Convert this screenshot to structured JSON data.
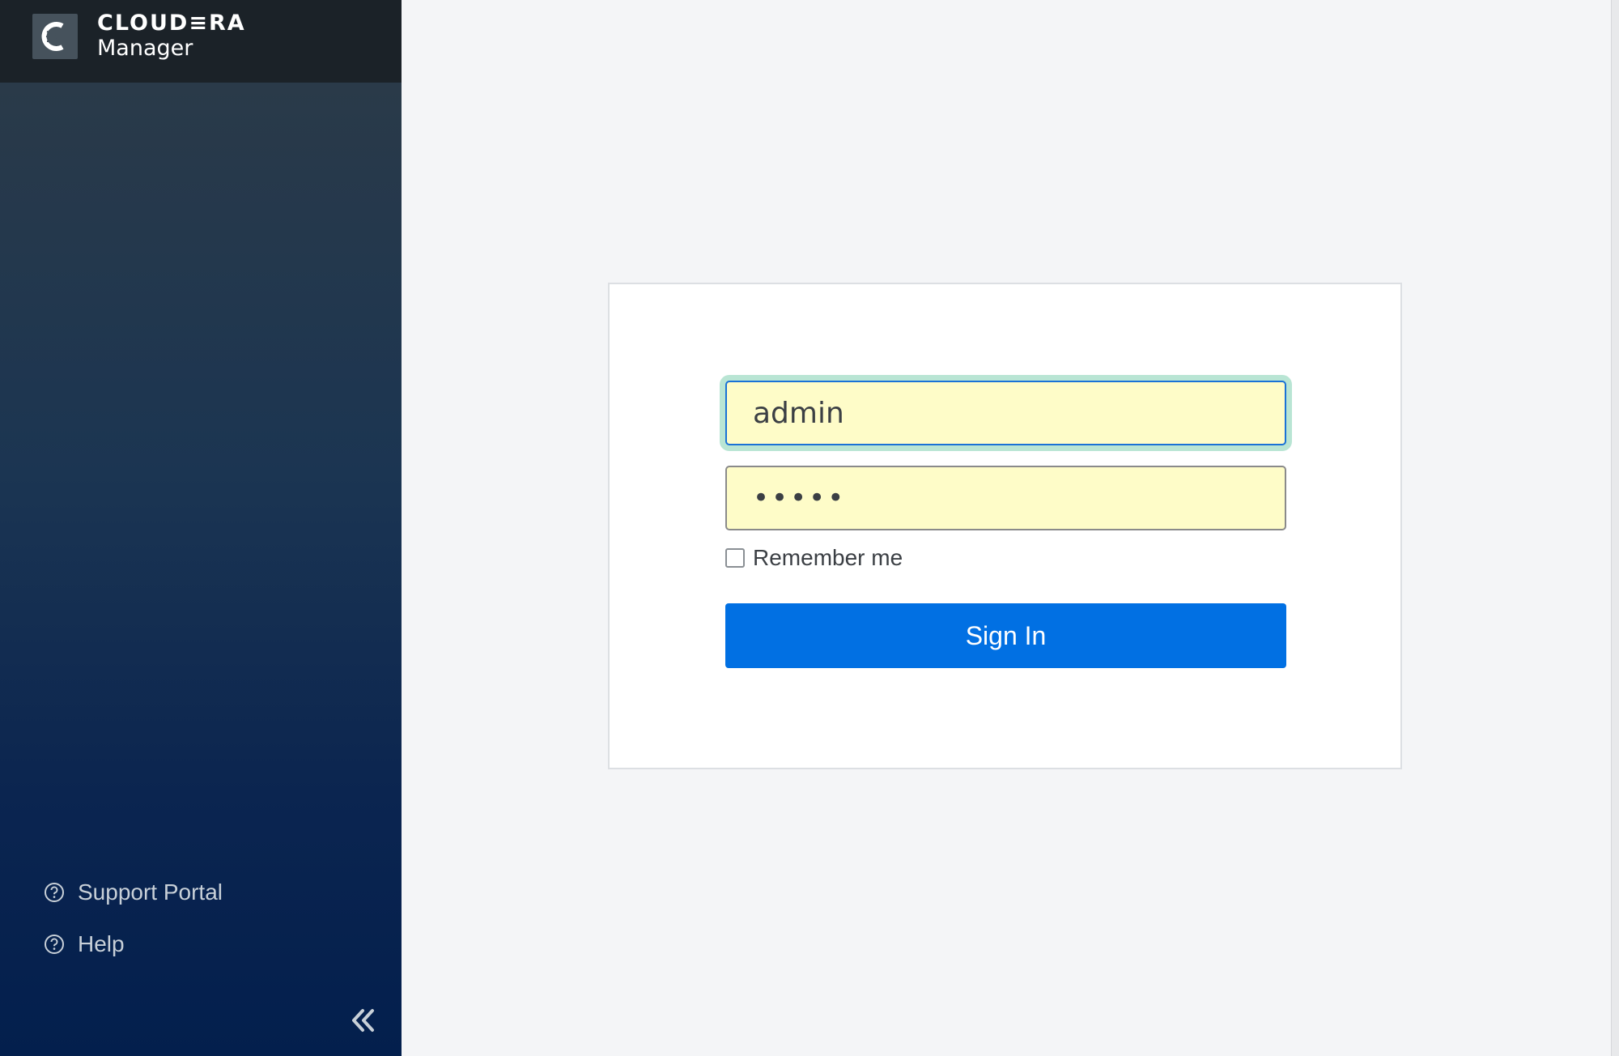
{
  "brand": {
    "name": "CLOUD≡RA",
    "product": "Manager"
  },
  "sidebar": {
    "links": [
      {
        "label": "Support Portal",
        "icon": "help-circle-icon"
      },
      {
        "label": "Help",
        "icon": "help-circle-icon"
      }
    ],
    "collapse_icon": "double-chevron-left-icon"
  },
  "login": {
    "username_value": "admin",
    "password_value": "•••••",
    "remember_label": "Remember me",
    "remember_checked": false,
    "signin_label": "Sign In"
  },
  "colors": {
    "sidebar_header": "#1b2228",
    "sidebar_bottom": "#031f4d",
    "input_fill": "#fefcc8",
    "focus_ring": "#b9e5d4",
    "primary_button": "#0170e3"
  }
}
